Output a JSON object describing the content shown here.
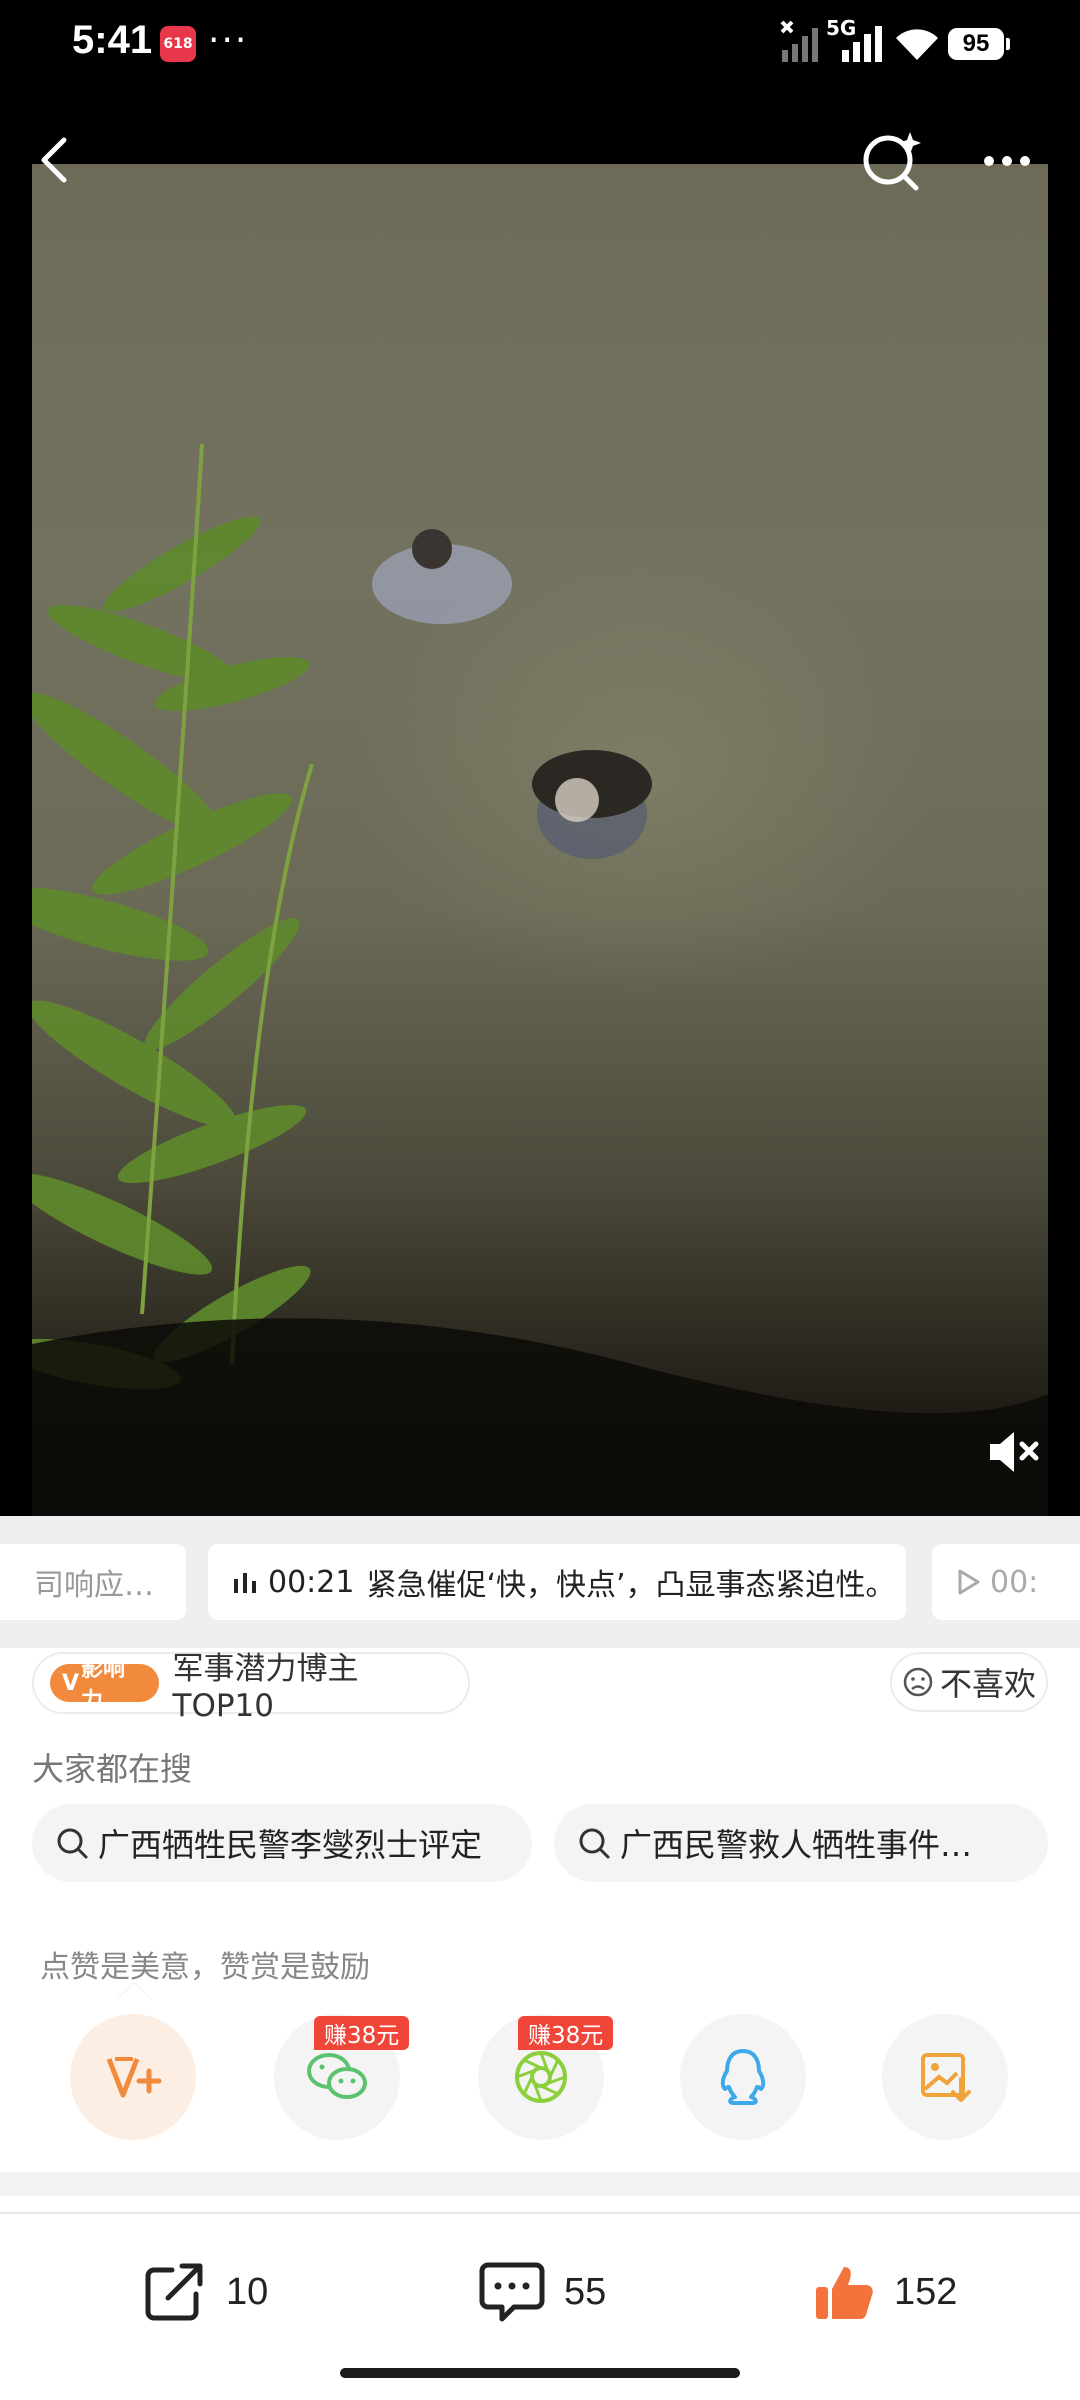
{
  "status_bar": {
    "time": "5:41",
    "app_badge": "618",
    "network": "5G",
    "battery": "95"
  },
  "chips": {
    "left": "司响应…",
    "main_time": "00:21",
    "main_text": "紧急催促‘快，快点’，凸显事态紧迫性。",
    "right_time": "00:"
  },
  "influence": {
    "badge": "影响力",
    "text": "军事潜力博主 TOP10"
  },
  "dislike_label": "不喜欢",
  "hot_search": {
    "title": "大家都在搜",
    "items": [
      "广西牺牲民警李燮烈士评定",
      "广西民警救人牺牲事件…"
    ]
  },
  "reward_hint": "点赞是美意，赞赏是鼓励",
  "earn_badge": "赚38元",
  "actions": {
    "share_count": "10",
    "comment_count": "55",
    "like_count": "152"
  },
  "colors": {
    "accent_orange": "#f18a3c",
    "earn_red": "#f0463a",
    "wechat_green": "#5bc26e",
    "moments_green": "#8ccf3c",
    "qq_blue": "#3fa8e8",
    "save_orange": "#f0a33a"
  }
}
